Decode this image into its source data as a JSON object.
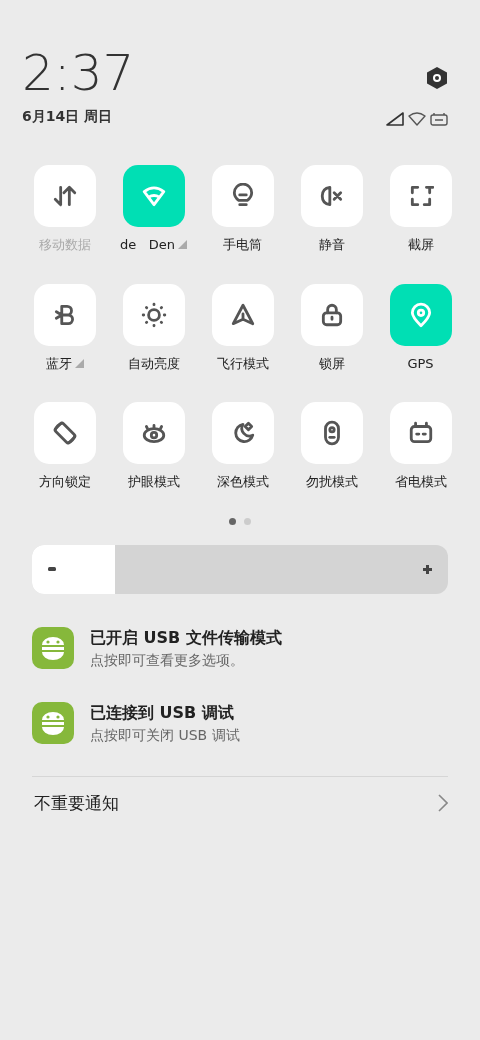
{
  "header": {
    "time": "2:37",
    "date": "6月14日 周日"
  },
  "tiles": [
    {
      "label": "移动数据",
      "on": false,
      "disabled": true,
      "menu": false
    },
    {
      "label": "de   Den",
      "on": true,
      "disabled": false,
      "menu": true
    },
    {
      "label": "手电筒",
      "on": false,
      "disabled": false,
      "menu": false
    },
    {
      "label": "静音",
      "on": false,
      "disabled": false,
      "menu": false
    },
    {
      "label": "截屏",
      "on": false,
      "disabled": false,
      "menu": false
    },
    {
      "label": "蓝牙",
      "on": false,
      "disabled": false,
      "menu": true
    },
    {
      "label": "自动亮度",
      "on": false,
      "disabled": false,
      "menu": false
    },
    {
      "label": "飞行模式",
      "on": false,
      "disabled": false,
      "menu": false
    },
    {
      "label": "锁屏",
      "on": false,
      "disabled": false,
      "menu": false
    },
    {
      "label": "GPS",
      "on": true,
      "disabled": false,
      "menu": false
    },
    {
      "label": "方向锁定",
      "on": false,
      "disabled": false,
      "menu": false
    },
    {
      "label": "护眼模式",
      "on": false,
      "disabled": false,
      "menu": false
    },
    {
      "label": "深色模式",
      "on": false,
      "disabled": false,
      "menu": false
    },
    {
      "label": "勿扰模式",
      "on": false,
      "disabled": false,
      "menu": false
    },
    {
      "label": "省电模式",
      "on": false,
      "disabled": false,
      "menu": false
    }
  ],
  "pages": [
    {
      "selected": true
    },
    {
      "selected": false
    }
  ],
  "brightness": {
    "level": 0.2
  },
  "notifications": [
    {
      "title": "已开启 USB 文件传输模式",
      "text": "点按即可查看更多选项。"
    },
    {
      "title": "已连接到 USB 调试",
      "text": "点按即可关闭 USB 调试"
    }
  ],
  "footer": {
    "label": "不重要通知"
  }
}
